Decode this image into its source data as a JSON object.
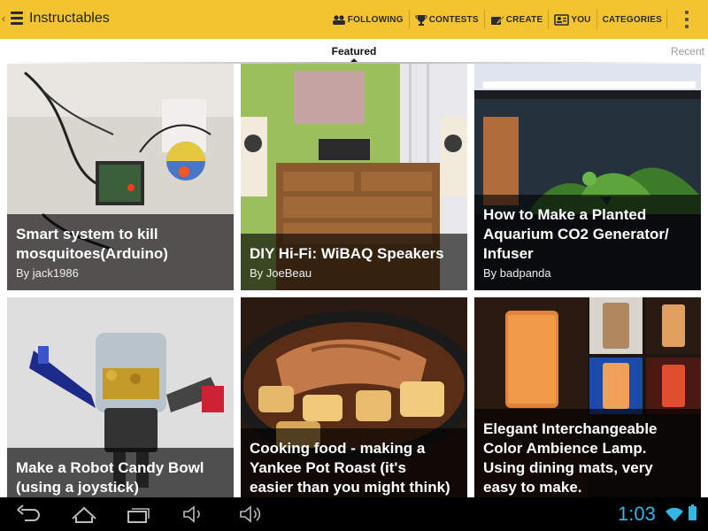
{
  "app": {
    "title": "Instructables"
  },
  "actions": [
    {
      "label": "FOLLOWING",
      "icon": "following-icon"
    },
    {
      "label": "CONTESTS",
      "icon": "trophy-icon"
    },
    {
      "label": "CREATE",
      "icon": "create-icon"
    },
    {
      "label": "YOU",
      "icon": "profile-icon"
    },
    {
      "label": "CATEGORIES",
      "icon": ""
    }
  ],
  "tabs": {
    "featured": "Featured",
    "recent": "Recent"
  },
  "cards": [
    {
      "title_lines": [
        "Smart system to kill",
        "mosquitoes(Arduino)"
      ],
      "author": "By jack1986"
    },
    {
      "title_lines": [
        "DIY Hi-Fi: WiBAQ Speakers"
      ],
      "author": "By JoeBeau"
    },
    {
      "title_lines": [
        "How to Make a Planted",
        "Aquarium CO2 Generator/",
        "Infuser"
      ],
      "author": "By badpanda"
    },
    {
      "title_lines": [
        "Make a Robot Candy Bowl",
        "(using a joystick)"
      ],
      "author": ""
    },
    {
      "title_lines": [
        "Cooking food - making a",
        "Yankee Pot Roast (it's",
        "easier than you might think)"
      ],
      "author": ""
    },
    {
      "title_lines": [
        "Elegant Interchangeable",
        "Color Ambience Lamp.",
        "Using dining mats, very",
        "easy to make."
      ],
      "author": ""
    }
  ],
  "status": {
    "time": "1:03"
  },
  "colors": {
    "action_bar": "#f4c430",
    "clock": "#33b5e5",
    "system_bar": "#000000"
  }
}
